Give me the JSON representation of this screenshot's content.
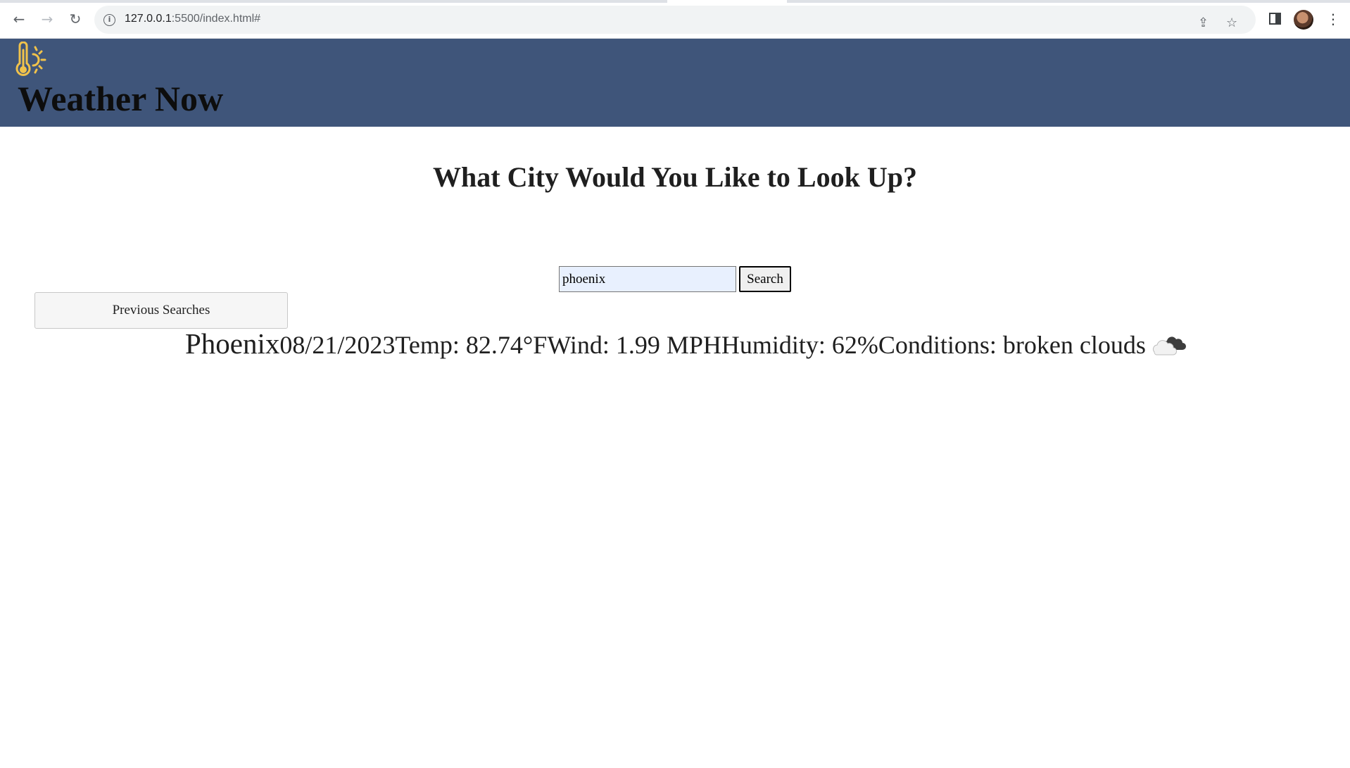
{
  "browser": {
    "url_host": "127.0.0.1",
    "url_rest": ":5500/index.html#"
  },
  "header": {
    "title": "Weather Now",
    "logo_icon": "thermometer-sun-icon",
    "logo_color": "#f0c24b",
    "background": "#3f557a"
  },
  "main": {
    "prompt": "What City Would You Like to Look Up?",
    "search": {
      "value": "phoenix",
      "button_label": "Search"
    },
    "previous_searches_label": "Previous Searches",
    "result": {
      "city": "Phoenix",
      "date": "08/21/2023",
      "temp": "Temp: 82.74°F",
      "wind": "Wind: 1.99 MPH",
      "humidity": "Humidity: 62%",
      "conditions": "Conditions: broken clouds",
      "condition_icon": "broken-clouds-icon"
    }
  }
}
